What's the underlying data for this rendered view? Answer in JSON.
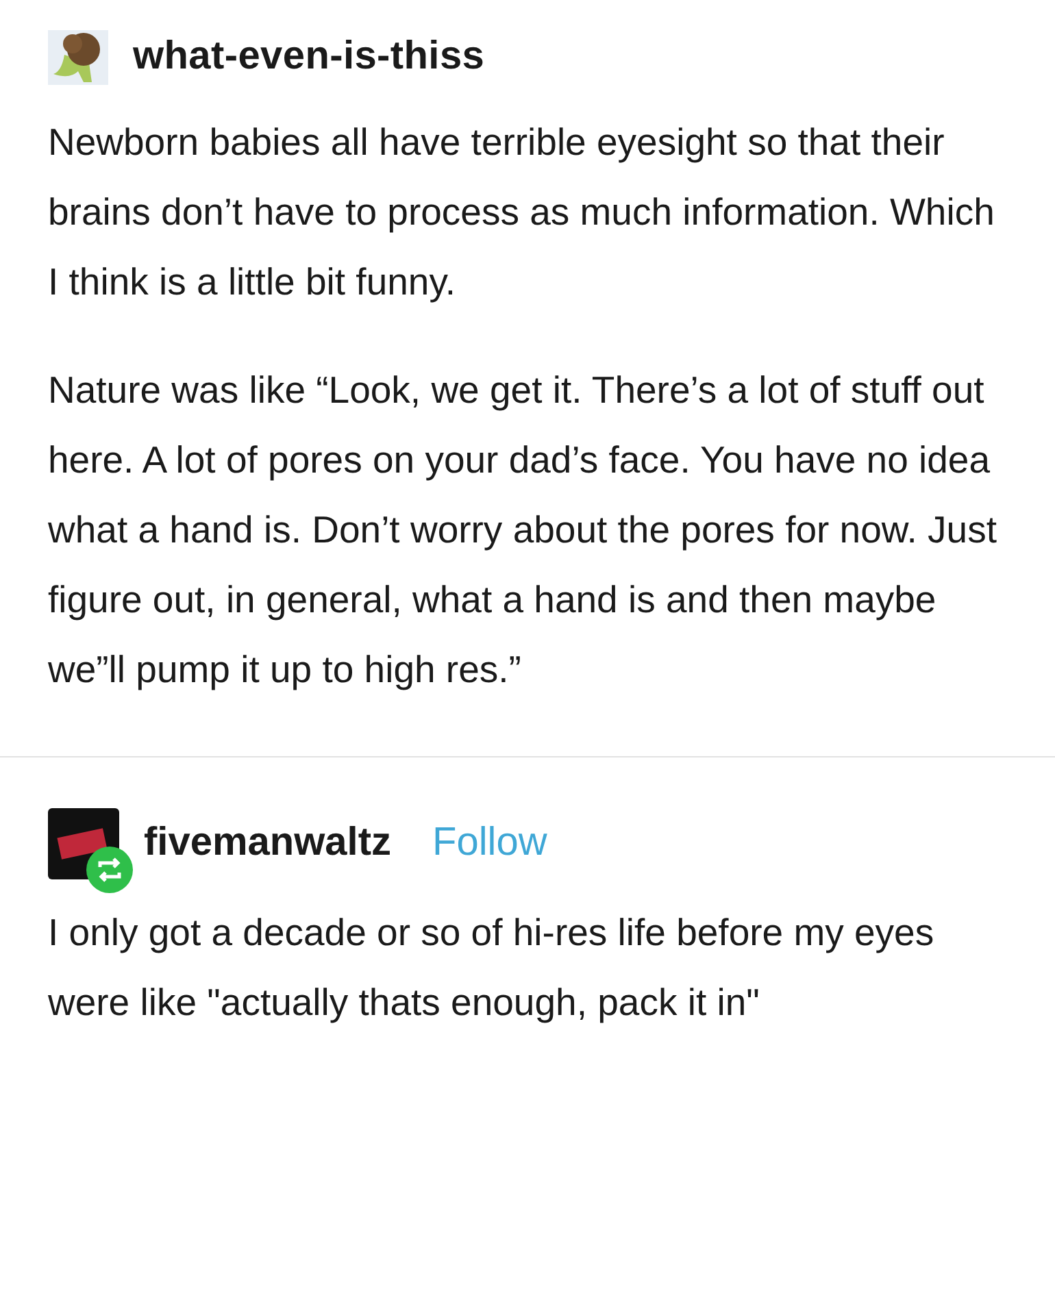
{
  "post": {
    "username": "what-even-is-thiss",
    "paragraphs": [
      "Newborn babies all have terrible eyesight so that their brains don’t have to process as much information. Which I think is a little bit funny.",
      "Nature was like “Look, we get it. There’s a lot of stuff out here. A lot of pores on your dad’s face. You have no idea what a hand is. Don’t worry about the pores for now. Just figure out, in general, what a hand is and then maybe we”ll pump it up to high res.”"
    ]
  },
  "reply": {
    "username": "fivemanwaltz",
    "follow": "Follow",
    "paragraphs": [
      "I only got a decade or so of hi-res life before my eyes were like \"actually thats enough, pack it in\""
    ]
  }
}
